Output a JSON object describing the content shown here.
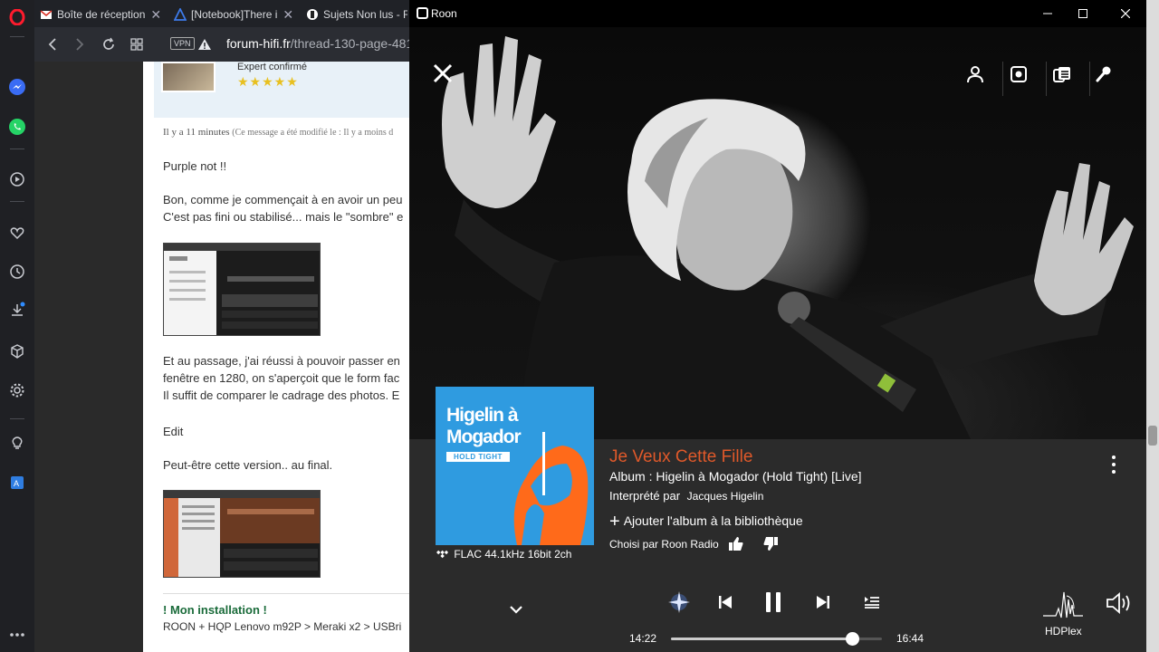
{
  "browser": {
    "tabs": [
      {
        "label": "Boîte de réception"
      },
      {
        "label": "[Notebook]There i"
      },
      {
        "label": "Sujets Non lus - R"
      }
    ],
    "vpn_label": "VPN",
    "url_domain": "forum-hifi.fr",
    "url_path": "/thread-130-page-481"
  },
  "forum": {
    "rank": "Expert confirmé",
    "stars": "★★★★★",
    "posted_ago": "Il y a 11 minutes",
    "edited_note": "(Ce message a été modifié le : Il y a moins d",
    "p1": "Purple not !!",
    "p2a": "Bon, comme je commençait à en avoir un peu",
    "p2b": "C'est pas fini ou stabilisé... mais le \"sombre\" e",
    "p3a": "Et au passage, j'ai réussi à pouvoir passer en",
    "p3b": "fenêtre en 1280, on s'aperçoit que le form fac",
    "p3c": "Il suffit de comparer le cadrage des photos. E",
    "p4": "Edit",
    "p5": "Peut-être cette version.. au final.",
    "sig_title": "! Mon installation !",
    "sig_line": "ROON + HQP Lenovo m92P > Meraki x2 > USBri"
  },
  "roon": {
    "window_title": "Roon",
    "track_title": "Je Veux Cette Fille",
    "album_line": "Album : Higelin à Mogador (Hold Tight) [Live]",
    "performed_by_label": "Interprété par",
    "artist": "Jacques Higelin",
    "add_to_library": "Ajouter l'album à la bibliothèque",
    "chosen_by": "Choisi par Roon Radio",
    "format": "FLAC 44.1kHz 16bit 2ch",
    "cover_line1": "Higelin à",
    "cover_line2": "Mogador",
    "cover_badge": "HOLD TIGHT",
    "elapsed": "14:22",
    "duration": "16:44",
    "progress": 0.86,
    "zone": "HDPlex",
    "accent": "#e0592a"
  }
}
